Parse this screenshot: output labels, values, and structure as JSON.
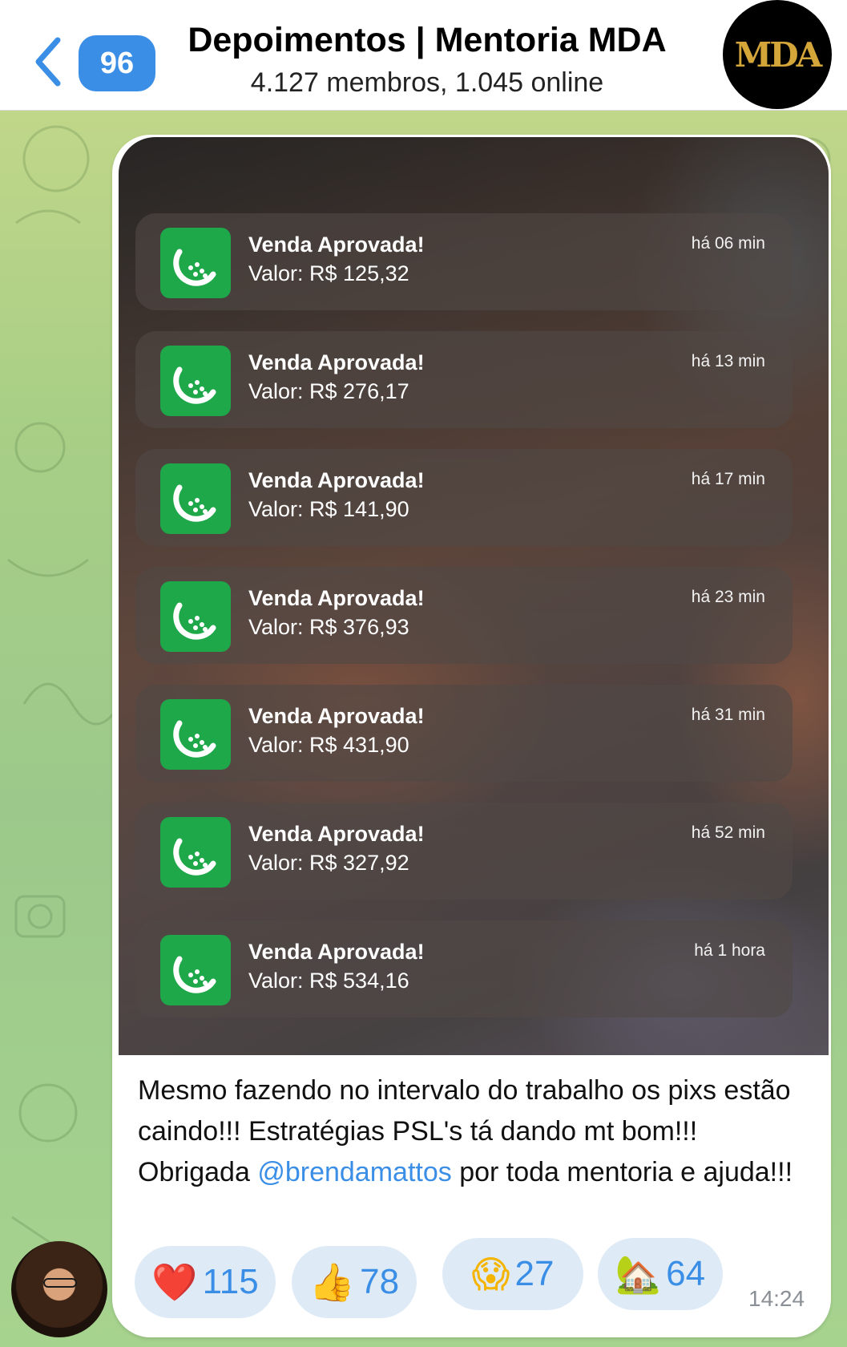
{
  "header": {
    "back_label": "‹",
    "unread_count": "96",
    "title": "Depoimentos | Mentoria MDA",
    "subtitle": "4.127 membros, 1.045 online",
    "avatar_logo_text": "MDA"
  },
  "message": {
    "notifications": [
      {
        "title": "Venda Aprovada!",
        "value": "Valor: R$ 125,32",
        "time": "há 06 min"
      },
      {
        "title": "Venda Aprovada!",
        "value": "Valor: R$ 276,17",
        "time": "há 13 min"
      },
      {
        "title": "Venda Aprovada!",
        "value": "Valor: R$ 141,90",
        "time": "há 17 min"
      },
      {
        "title": "Venda Aprovada!",
        "value": "Valor: R$ 376,93",
        "time": "há 23 min"
      },
      {
        "title": "Venda Aprovada!",
        "value": "Valor: R$ 431,90",
        "time": "há 31 min"
      },
      {
        "title": "Venda Aprovada!",
        "value": "Valor: R$ 327,92",
        "time": "há 52 min"
      },
      {
        "title": "Venda Aprovada!",
        "value": "Valor: R$ 534,16",
        "time": "há 1 hora"
      }
    ],
    "caption_before": "Mesmo fazendo no intervalo do trabalho os pixs estão caindo!!! Estratégias PSL's tá dando mt bom!!! Obrigada ",
    "caption_mention": "@brendamattos",
    "caption_after": " por toda mentoria e ajuda!!!",
    "reactions": [
      {
        "emoji": "❤️",
        "count": "115"
      },
      {
        "emoji": "👍",
        "count": "78"
      },
      {
        "emoji": "😱",
        "count": "27"
      },
      {
        "emoji": "🏡",
        "count": "64"
      }
    ],
    "time": "14:24"
  },
  "colors": {
    "accent": "#3a8ee6",
    "app_icon_green": "#1ea84a",
    "bubble": "#ffffff",
    "reaction_bg": "#deebf7"
  }
}
